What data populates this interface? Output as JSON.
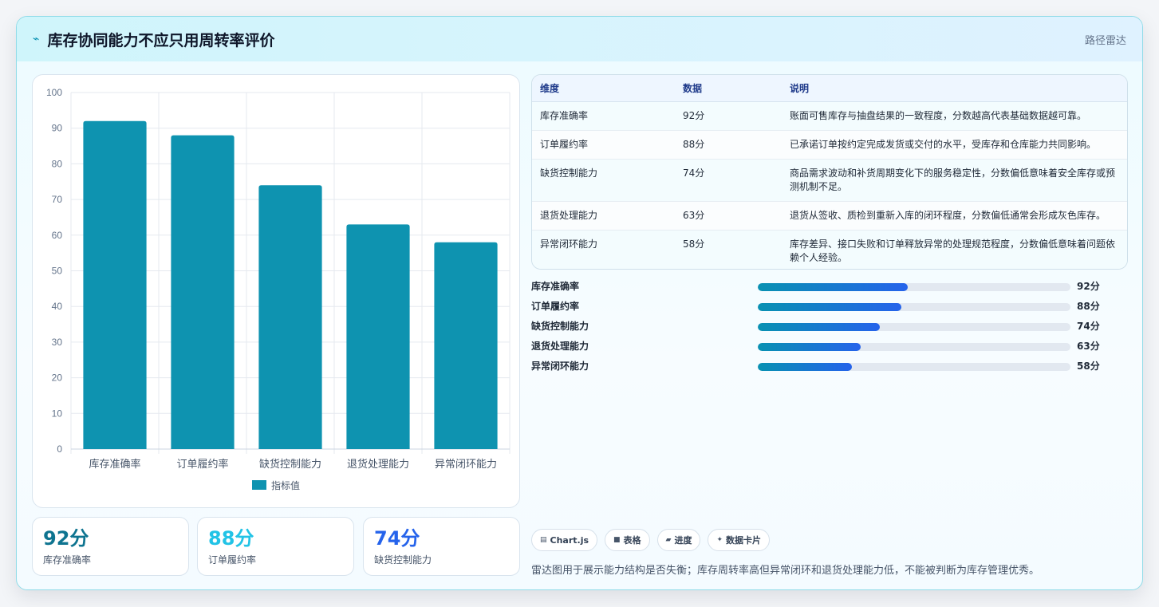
{
  "header": {
    "logo_icon": "trend-line-icon",
    "title": "库存协同能力不应只用周转率评价",
    "tag": "路径雷达"
  },
  "chart_data": {
    "type": "bar",
    "categories": [
      "库存准确率",
      "订单履约率",
      "缺货控制能力",
      "退货处理能力",
      "异常闭环能力"
    ],
    "series": [
      {
        "name": "指标值",
        "values": [
          92,
          88,
          74,
          63,
          58
        ],
        "color": "#0e93b0"
      }
    ],
    "ylim": [
      0,
      100
    ],
    "yticks": [
      0,
      10,
      20,
      30,
      40,
      50,
      60,
      70,
      80,
      90,
      100
    ],
    "grid": true,
    "legend": "bottom"
  },
  "stats": [
    {
      "value": "92分",
      "label": "库存准确率",
      "color": "#0e7490"
    },
    {
      "value": "88分",
      "label": "订单履约率",
      "color": "#22c3e6"
    },
    {
      "value": "74分",
      "label": "缺货控制能力",
      "color": "#2563eb"
    }
  ],
  "table": {
    "headers": [
      "维度",
      "数据",
      "说明"
    ],
    "rows": [
      [
        "库存准确率",
        "92分",
        "账面可售库存与抽盘结果的一致程度，分数越高代表基础数据越可靠。"
      ],
      [
        "订单履约率",
        "88分",
        "已承诺订单按约定完成发货或交付的水平，受库存和仓库能力共同影响。"
      ],
      [
        "缺货控制能力",
        "74分",
        "商品需求波动和补货周期变化下的服务稳定性，分数偏低意味着安全库存或预测机制不足。"
      ],
      [
        "退货处理能力",
        "63分",
        "退货从签收、质检到重新入库的闭环程度，分数偏低通常会形成灰色库存。"
      ],
      [
        "异常闭环能力",
        "58分",
        "库存差异、接口失败和订单释放异常的处理规范程度，分数偏低意味着问题依赖个人经验。"
      ]
    ]
  },
  "progress": [
    {
      "label": "库存准确率",
      "value": "92分",
      "level": 0.48
    },
    {
      "label": "订单履约率",
      "value": "88分",
      "level": 0.46
    },
    {
      "label": "缺货控制能力",
      "value": "74分",
      "level": 0.39
    },
    {
      "label": "退货处理能力",
      "value": "63分",
      "level": 0.33
    },
    {
      "label": "异常闭环能力",
      "value": "58分",
      "level": 0.3
    }
  ],
  "chips": [
    {
      "icon": "chart-icon",
      "glyph": "▤",
      "label": "Chart.js"
    },
    {
      "icon": "table-icon",
      "glyph": "■",
      "label": "表格"
    },
    {
      "icon": "progress-icon",
      "glyph": "▰",
      "label": "进度"
    },
    {
      "icon": "card-icon",
      "glyph": "✦",
      "label": "数据卡片"
    }
  ],
  "footnote": "雷达图用于展示能力结构是否失衡；库存周转率高但异常闭环和退货处理能力低，不能被判断为库存管理优秀。"
}
